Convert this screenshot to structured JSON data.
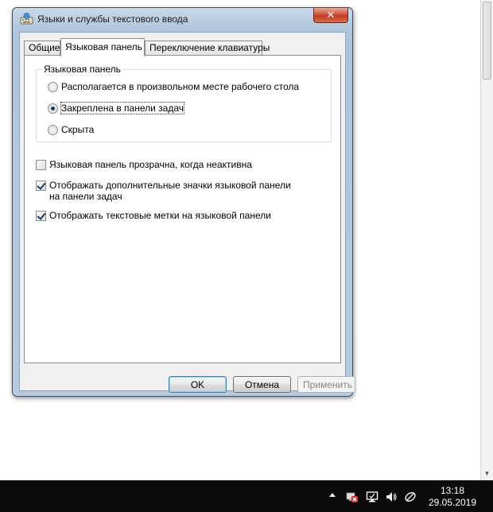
{
  "window": {
    "title": "Языки и службы текстового ввода",
    "close_glyph": "✕"
  },
  "tabs": [
    {
      "label": "Общие",
      "active": false
    },
    {
      "label": "Языковая панель",
      "active": true
    },
    {
      "label": "Переключение клавиатуры",
      "active": false
    }
  ],
  "group": {
    "label": "Языковая панель",
    "options": [
      {
        "label": "Располагается в произвольном месте рабочего стола",
        "checked": false
      },
      {
        "label": "Закреплена в панели задач",
        "checked": true
      },
      {
        "label": "Скрыта",
        "checked": false
      }
    ]
  },
  "checkboxes": [
    {
      "label": "Языковая панель прозрачна, когда неактивна",
      "checked": false
    },
    {
      "label": "Отображать дополнительные значки языковой панели на панели задач",
      "checked": true
    },
    {
      "label": "Отображать текстовые метки на языковой панели",
      "checked": true
    }
  ],
  "buttons": {
    "ok": "OK",
    "cancel": "Отмена",
    "apply": "Применить"
  },
  "taskbar": {
    "time": "13:18",
    "date": "29.05.2019",
    "tray_icons": [
      "network-error-icon",
      "display-icon",
      "volume-icon",
      "language-icon"
    ]
  },
  "colors": {
    "accent": "#3c7fb1",
    "close_red": "#c23b22",
    "taskbar": "#0b0b0b"
  }
}
